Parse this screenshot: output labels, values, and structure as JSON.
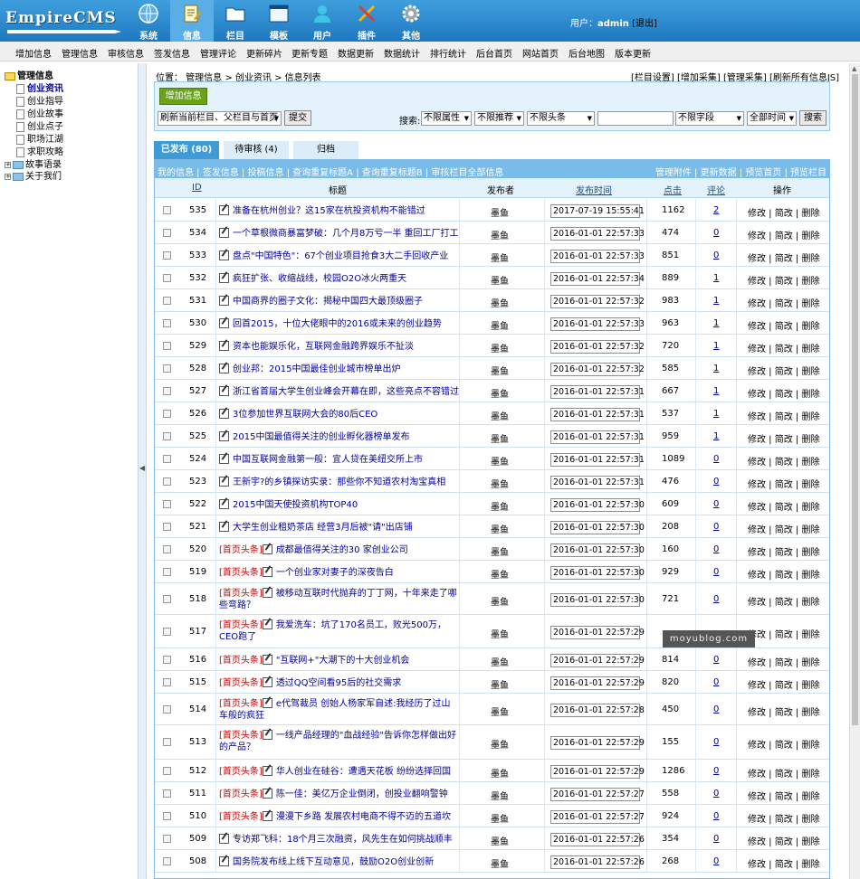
{
  "logo": "EmpireCMS",
  "nav": [
    {
      "label": "系统",
      "icon": "globe-icon"
    },
    {
      "label": "信息",
      "icon": "document-edit-icon"
    },
    {
      "label": "栏目",
      "icon": "folder-icon"
    },
    {
      "label": "模板",
      "icon": "window-icon"
    },
    {
      "label": "用户",
      "icon": "user-icon"
    },
    {
      "label": "插件",
      "icon": "tools-icon"
    },
    {
      "label": "其他",
      "icon": "gear-icon"
    }
  ],
  "user": {
    "label": "用户：",
    "name": "admin",
    "logout": "[退出]"
  },
  "menu": [
    "增加信息",
    "管理信息",
    "审核信息",
    "签发信息",
    "管理评论",
    "更新碎片",
    "更新专题",
    "数据更新",
    "数据统计",
    "排行统计",
    "后台首页",
    "网站首页",
    "后台地图",
    "版本更新"
  ],
  "tree": {
    "root": "管理信息",
    "items": [
      "创业资讯",
      "创业指导",
      "创业故事",
      "创业点子",
      "职场江湖",
      "求职攻略"
    ],
    "groups": [
      "故事语录",
      "关于我们"
    ]
  },
  "breadcrumb": "位置：  管理信息 > 创业资讯 > 信息列表",
  "toplinks": "[栏目设置] [增加采集] [管理采集] [刷新所有信息JS]",
  "search": {
    "add_button": "增加信息",
    "refresh_select": "刷新当前栏目、父栏目与首页",
    "submit": "提交",
    "search_label": "搜索:",
    "attr": "不限属性",
    "recommend": "不限推荐",
    "headline": "不限头条",
    "keyword": "",
    "field": "不限字段",
    "time": "全部时间",
    "search_button": "搜索"
  },
  "tabs": [
    "已发布 (80)",
    "待审核 (4)",
    "归档"
  ],
  "linkbar": {
    "left": "我的信息 | 签发信息 | 投稿信息 | 查询重复标题A | 查询重复标题B | 审核栏目全部信息",
    "right": "管理附件 | 更新数据 | 预览首页 | 预览栏目"
  },
  "columns": {
    "id": "ID",
    "title": "标题",
    "publisher": "发布者",
    "time": "发布时间",
    "hits": "点击",
    "comments": "评论",
    "ops": "操作"
  },
  "ops": "修改 | 简改 | 删除",
  "rows": [
    {
      "id": "535",
      "prefix": "",
      "title": "准备在杭州创业？这15家在杭投资机构不能错过",
      "pub": "墨鱼",
      "time": "2017-07-19 15:55:41",
      "hits": "1162",
      "cmt": "2"
    },
    {
      "id": "534",
      "prefix": "",
      "title": "一个草根微商暴富梦破：几个月8万亏一半 重回工厂打工",
      "pub": "墨鱼",
      "time": "2016-01-01 22:57:33",
      "hits": "474",
      "cmt": "0"
    },
    {
      "id": "533",
      "prefix": "",
      "title": "盘点\"中国特色\"：67个创业项目抢食3大二手回收产业",
      "pub": "墨鱼",
      "time": "2016-01-01 22:57:33",
      "hits": "851",
      "cmt": "0"
    },
    {
      "id": "532",
      "prefix": "",
      "title": "疯狂扩张、收缩战线，校园O2O冰火两重天",
      "pub": "墨鱼",
      "time": "2016-01-01 22:57:34",
      "hits": "889",
      "cmt": "1"
    },
    {
      "id": "531",
      "prefix": "",
      "title": "中国商界的圈子文化：揭秘中国四大最顶级圈子",
      "pub": "墨鱼",
      "time": "2016-01-01 22:57:32",
      "hits": "983",
      "cmt": "1"
    },
    {
      "id": "530",
      "prefix": "",
      "title": "回首2015，十位大佬眼中的2016或未来的创业趋势",
      "pub": "墨鱼",
      "time": "2016-01-01 22:57:33",
      "hits": "963",
      "cmt": "1"
    },
    {
      "id": "529",
      "prefix": "",
      "title": "资本也能娱乐化，互联网金融跨界娱乐不扯淡",
      "pub": "墨鱼",
      "time": "2016-01-01 22:57:32",
      "hits": "720",
      "cmt": "1"
    },
    {
      "id": "528",
      "prefix": "",
      "title": "创业邦：2015中国最佳创业城市榜单出炉",
      "pub": "墨鱼",
      "time": "2016-01-01 22:57:32",
      "hits": "585",
      "cmt": "1"
    },
    {
      "id": "527",
      "prefix": "",
      "title": "浙江省首届大学生创业峰会开幕在即，这些亮点不容错过",
      "pub": "墨鱼",
      "time": "2016-01-01 22:57:31",
      "hits": "667",
      "cmt": "1"
    },
    {
      "id": "526",
      "prefix": "",
      "title": "3位参加世界互联网大会的80后CEO",
      "pub": "墨鱼",
      "time": "2016-01-01 22:57:31",
      "hits": "537",
      "cmt": "1"
    },
    {
      "id": "525",
      "prefix": "",
      "title": "2015中国最值得关注的创业孵化器榜单发布",
      "pub": "墨鱼",
      "time": "2016-01-01 22:57:31",
      "hits": "959",
      "cmt": "1"
    },
    {
      "id": "524",
      "prefix": "",
      "title": "中国互联网金融第一般：宜人贷在美纽交所上市",
      "pub": "墨鱼",
      "time": "2016-01-01 22:57:31",
      "hits": "1089",
      "cmt": "0"
    },
    {
      "id": "523",
      "prefix": "",
      "title": "王新宇?的乡镇探访实录：那些你不知道农村淘宝真相",
      "pub": "墨鱼",
      "time": "2016-01-01 22:57:31",
      "hits": "476",
      "cmt": "0"
    },
    {
      "id": "522",
      "prefix": "",
      "title": "2015中国天使投资机构TOP40",
      "pub": "墨鱼",
      "time": "2016-01-01 22:57:30",
      "hits": "609",
      "cmt": "0"
    },
    {
      "id": "521",
      "prefix": "",
      "title": "大学生创业租奶茶店 经营3月后被\"请\"出店铺",
      "pub": "墨鱼",
      "time": "2016-01-01 22:57:30",
      "hits": "208",
      "cmt": "0"
    },
    {
      "id": "520",
      "prefix": "[首页头条]",
      "title": "成都最值得关注的30 家创业公司",
      "pub": "墨鱼",
      "time": "2016-01-01 22:57:30",
      "hits": "160",
      "cmt": "0"
    },
    {
      "id": "519",
      "prefix": "[首页头条]",
      "title": "一个创业家对妻子的深夜告白",
      "pub": "墨鱼",
      "time": "2016-01-01 22:57:30",
      "hits": "929",
      "cmt": "0"
    },
    {
      "id": "518",
      "prefix": "[首页头条]",
      "title": "被移动互联时代抛弃的丁丁网，十年来走了哪些弯路？",
      "pub": "墨鱼",
      "time": "2016-01-01 22:57:30",
      "hits": "721",
      "cmt": "0"
    },
    {
      "id": "517",
      "prefix": "[首页头条]",
      "title": "我爱洗车：坑了170名员工，败光500万，CEO跑了",
      "pub": "墨鱼",
      "time": "2016-01-01 22:57:29",
      "hits": "",
      "cmt": ""
    },
    {
      "id": "516",
      "prefix": "[首页头条]",
      "title": "\"互联网+\"大潮下的十大创业机会",
      "pub": "墨鱼",
      "time": "2016-01-01 22:57:29",
      "hits": "814",
      "cmt": "0"
    },
    {
      "id": "515",
      "prefix": "[首页头条]",
      "title": "透过QQ空间看95后的社交需求",
      "pub": "墨鱼",
      "time": "2016-01-01 22:57:29",
      "hits": "820",
      "cmt": "0"
    },
    {
      "id": "514",
      "prefix": "[首页头条]",
      "title": "e代驾裁员 创始人杨家军自述:我经历了过山车般的疯狂",
      "pub": "墨鱼",
      "time": "2016-01-01 22:57:28",
      "hits": "450",
      "cmt": "0"
    },
    {
      "id": "513",
      "prefix": "[首页头条]",
      "title": "一线产品经理的\"血战经验\"告诉你怎样做出好的产品？",
      "pub": "墨鱼",
      "time": "2016-01-01 22:57:29",
      "hits": "155",
      "cmt": "0"
    },
    {
      "id": "512",
      "prefix": "[首页头条]",
      "title": "华人创业在硅谷：遭遇天花板 纷纷选择回国",
      "pub": "墨鱼",
      "time": "2016-01-01 22:57:29",
      "hits": "1286",
      "cmt": "0"
    },
    {
      "id": "511",
      "prefix": "[首页头条]",
      "title": "陈一佳：美亿万企业倒闭，创投业翻响警钟",
      "pub": "墨鱼",
      "time": "2016-01-01 22:57:27",
      "hits": "558",
      "cmt": "0"
    },
    {
      "id": "510",
      "prefix": "[首页头条]",
      "title": "漫漫下乡路 发展农村电商不得不迈的五道坎",
      "pub": "墨鱼",
      "time": "2016-01-01 22:57:27",
      "hits": "924",
      "cmt": "0"
    },
    {
      "id": "509",
      "prefix": "",
      "title": "专访郑飞科：18个月三次融资，风先生在如何挑战顺丰",
      "pub": "墨鱼",
      "time": "2016-01-01 22:57:26",
      "hits": "354",
      "cmt": "0"
    },
    {
      "id": "508",
      "prefix": "",
      "title": "国务院发布线上线下互动意见，鼓励O2O创业创新",
      "pub": "墨鱼",
      "time": "2016-01-01 22:57:26",
      "hits": "268",
      "cmt": "0"
    }
  ],
  "watermark": "moyublog.com"
}
